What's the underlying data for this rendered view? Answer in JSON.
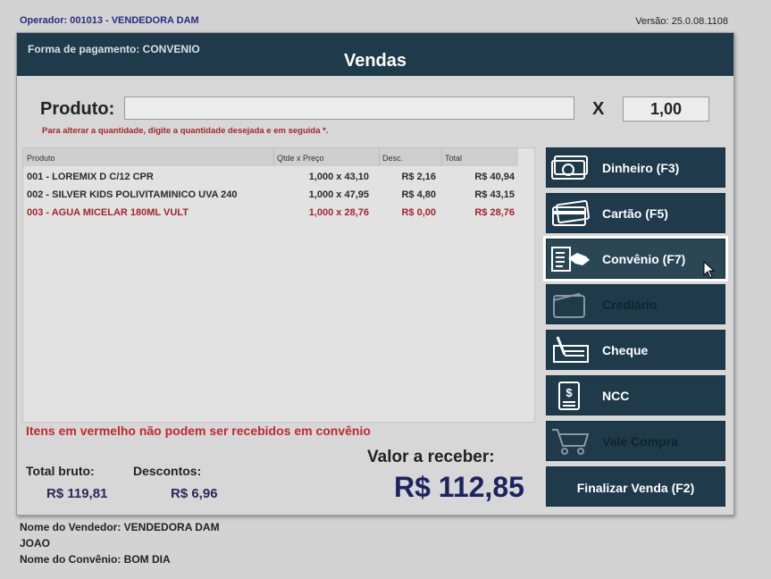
{
  "topbar": {
    "operator": "Operador: 001013 - VENDEDORA DAM",
    "version": "Versão: 25.0.08.1108"
  },
  "window": {
    "payment_form": "Forma de pagamento: CONVENIO",
    "title": "Vendas"
  },
  "product": {
    "label": "Produto:",
    "value": "",
    "x_label": "X",
    "quantity": "1,00",
    "hint": "Para alterar a quantidade, digite a quantidade desejada e em seguida *."
  },
  "grid": {
    "headers": [
      "Produto",
      "Qtde x Preço",
      "Desc.",
      "Total"
    ],
    "rows": [
      {
        "product": "001 - LOREMIX D C/12 CPR",
        "qty_price": "1,000 x 43,10",
        "discount": "R$ 2,16",
        "total": "R$ 40,94"
      },
      {
        "product": "002 - SILVER KIDS POLIVITAMINICO UVA 240",
        "qty_price": "1,000 x 47,95",
        "discount": "R$ 4,80",
        "total": "R$ 43,15"
      },
      {
        "product": "003 - AGUA MICELAR 180ML VULT",
        "qty_price": "1,000 x 28,76",
        "discount": "R$ 0,00",
        "total": "R$ 28,76"
      }
    ]
  },
  "warning": "Itens em vermelho não podem ser recebidos em convênio",
  "totals": {
    "bruto_label": "Total bruto:",
    "bruto_value": "R$ 119,81",
    "descontos_label": "Descontos:",
    "descontos_value": "R$ 6,96",
    "receber_label": "Valor a receber:",
    "receber_value": "R$ 112,85"
  },
  "buttons": {
    "dinheiro": "Dinheiro (F3)",
    "cartao": "Cartão (F5)",
    "convenio": "Convênio (F7)",
    "crediario": "Crediário",
    "cheque": "Cheque",
    "ncc": "NCC",
    "vale_compra": "Vale Compra",
    "finalizar": "Finalizar Venda (F2)"
  },
  "footer": {
    "vendedor": "Nome do Vendedor: VENDEDORA DAM",
    "cliente": "JOAO",
    "convenio": "Nome do Convênio: BOM DIA"
  },
  "colors": {
    "header_bg": "#1f3a4a",
    "error_red": "#c0282c",
    "total_blue": "#1e2360"
  }
}
